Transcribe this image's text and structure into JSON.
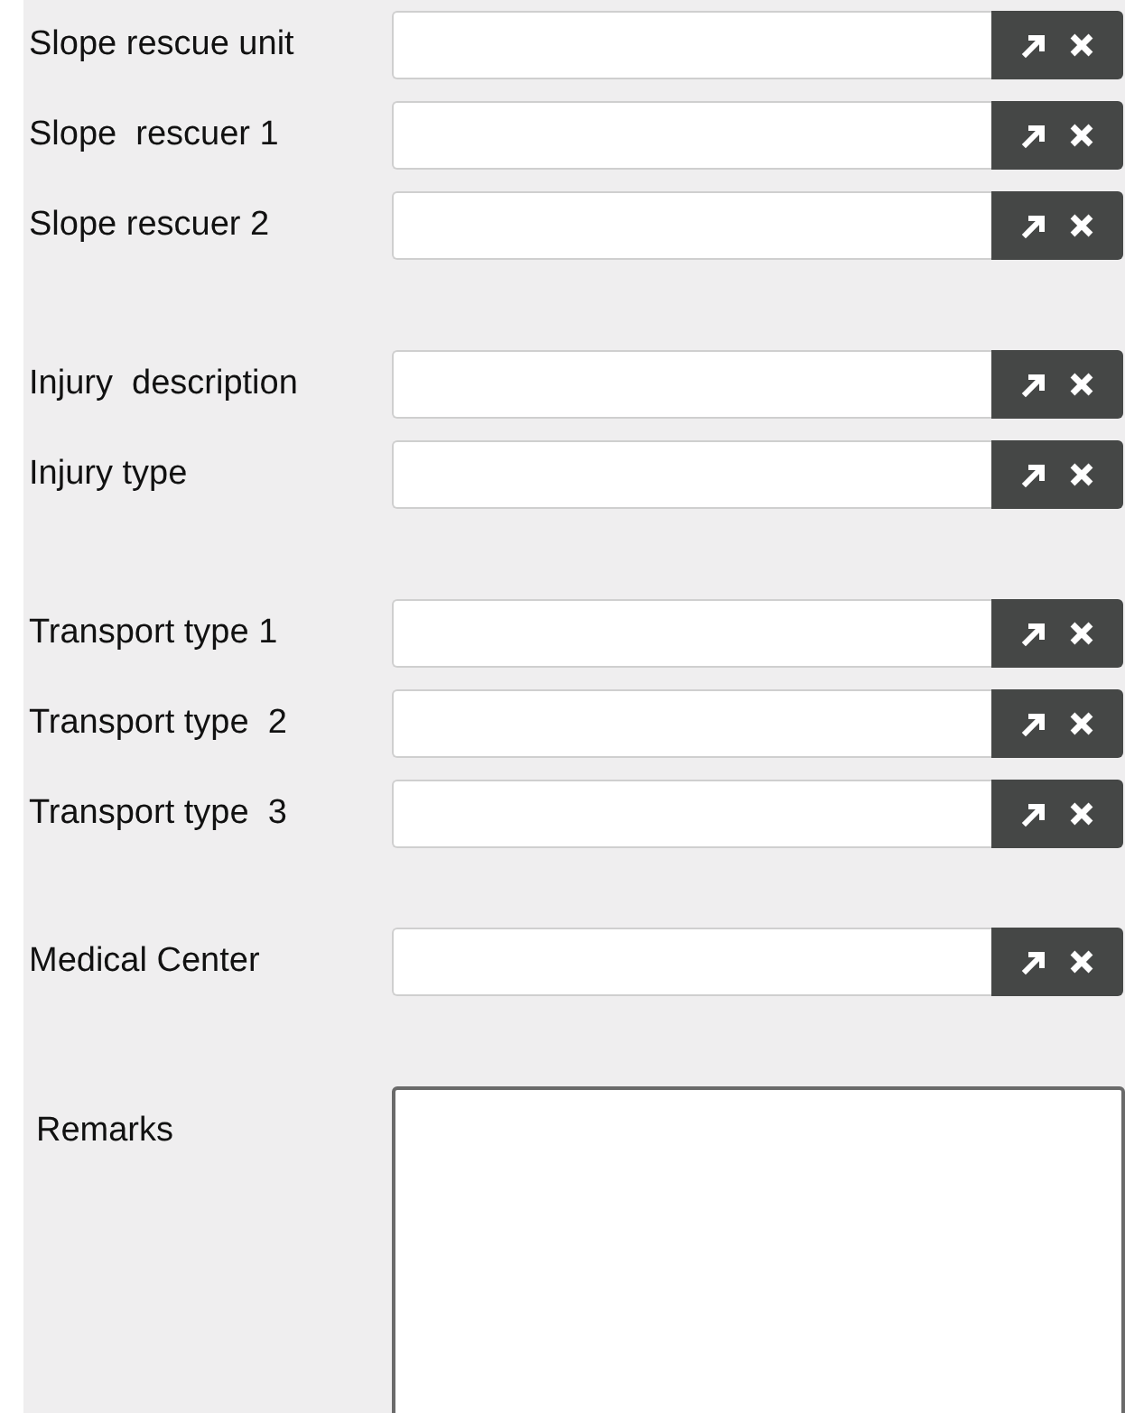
{
  "groups": [
    {
      "fields": [
        {
          "label": "Slope rescue unit"
        },
        {
          "label": "Slope  rescuer 1"
        },
        {
          "label": "Slope rescuer 2"
        }
      ]
    },
    {
      "fields": [
        {
          "label": "Injury  description"
        },
        {
          "label": "Injury type"
        }
      ]
    },
    {
      "fields": [
        {
          "label": "Transport type 1"
        },
        {
          "label": "Transport type  2"
        },
        {
          "label": "Transport type  3"
        }
      ]
    },
    {
      "fields": [
        {
          "label": "Medical Center"
        }
      ]
    }
  ],
  "remarks": {
    "label": "Remarks"
  }
}
